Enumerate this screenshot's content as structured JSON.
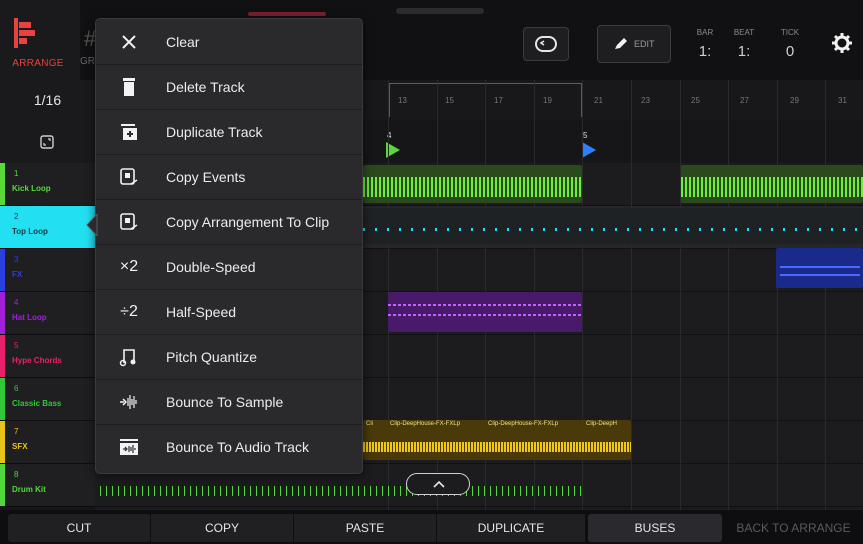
{
  "header": {
    "arrange_label": "ARRANGE",
    "grid_label": "GR",
    "edit_label": "EDIT",
    "bar_label": "BAR",
    "beat_label": "BEAT",
    "tick_label": "TICK",
    "bar_value": "1:",
    "beat_value": "1:",
    "tick_value": "0"
  },
  "quantize": "1/16",
  "tracks": [
    {
      "num": "1",
      "name": "Kick Loop",
      "color": "#5ad83a"
    },
    {
      "num": "2",
      "name": "Top Loop",
      "color": "#22e0f2"
    },
    {
      "num": "3",
      "name": "FX",
      "color": "#2b3fe0"
    },
    {
      "num": "4",
      "name": "Hat Loop",
      "color": "#a020d8"
    },
    {
      "num": "5",
      "name": "Hype Chords",
      "color": "#e8206a"
    },
    {
      "num": "6",
      "name": "Classic Bass",
      "color": "#30c838"
    },
    {
      "num": "7",
      "name": "SFX",
      "color": "#e8c318"
    },
    {
      "num": "8",
      "name": "Drum Kit",
      "color": "#52d83a"
    }
  ],
  "ruler_ticks": [
    "13",
    "15",
    "17",
    "19",
    "21",
    "23",
    "25",
    "27",
    "29",
    "31"
  ],
  "loop_markers": {
    "start": "4",
    "end": "5"
  },
  "clip_labels": {
    "sfx_a": "Clip-DeepHouse-FX-FXLp",
    "sfx_b": "Clip-DeepHouse-FX-FXLp",
    "sfx_c": "Clip-DeepH",
    "sfx_left": "Cli"
  },
  "menu": {
    "items": [
      {
        "icon": "close-icon",
        "label": "Clear"
      },
      {
        "icon": "trash-icon",
        "label": "Delete Track"
      },
      {
        "icon": "duplicate-track-icon",
        "label": "Duplicate Track"
      },
      {
        "icon": "copy-events-icon",
        "label": "Copy Events"
      },
      {
        "icon": "copy-to-clip-icon",
        "label": "Copy Arrangement To Clip"
      },
      {
        "icon": "double-speed-icon",
        "icon_text": "×2",
        "label": "Double-Speed"
      },
      {
        "icon": "half-speed-icon",
        "icon_text": "÷2",
        "label": "Half-Speed"
      },
      {
        "icon": "pitch-quantize-icon",
        "label": "Pitch Quantize"
      },
      {
        "icon": "bounce-sample-icon",
        "label": "Bounce To Sample"
      },
      {
        "icon": "bounce-audio-icon",
        "label": "Bounce To Audio Track"
      }
    ]
  },
  "bottom_bar": {
    "cut": "CUT",
    "copy": "COPY",
    "paste": "PASTE",
    "duplicate": "DUPLICATE",
    "buses": "BUSES",
    "back": "BACK TO ARRANGE"
  },
  "colors": {
    "accent": "#e8413f",
    "selected_track": "#22e0f2",
    "loop_start": "#5ad83a",
    "loop_end": "#2f7fff"
  }
}
